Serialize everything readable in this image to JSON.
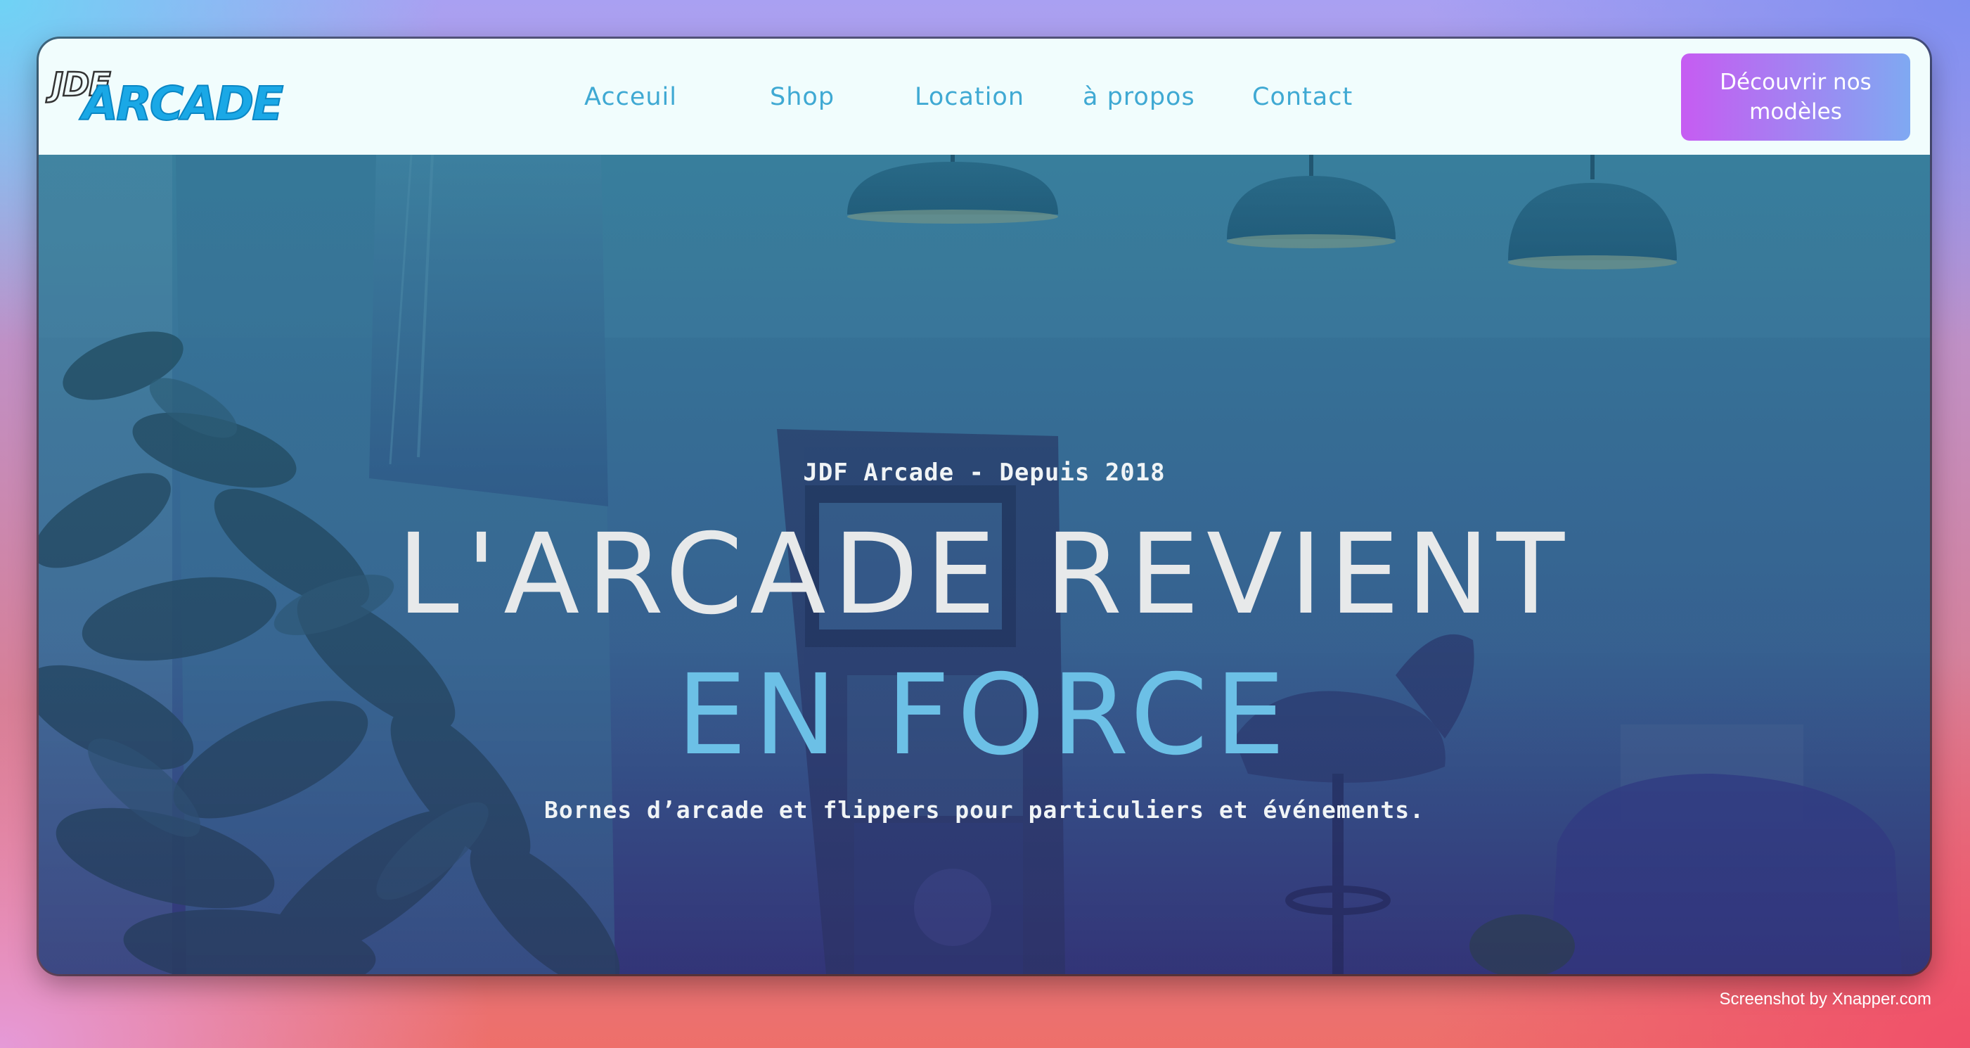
{
  "header": {
    "logo": {
      "top": "JDF",
      "bottom": "ARCADE"
    },
    "nav": [
      {
        "label": "Acceuil"
      },
      {
        "label": "Shop"
      },
      {
        "label": "Location"
      },
      {
        "label": "à propos"
      },
      {
        "label": "Contact"
      }
    ],
    "cta_label": "Découvrir nos modèles"
  },
  "hero": {
    "eyebrow": "JDF Arcade - Depuis 2018",
    "title_line1": "L'ARCADE REVIENT",
    "title_line2": "EN FORCE",
    "subtitle": "Bornes d’arcade et flippers pour particuliers et événements."
  },
  "footer": {
    "credit": "Screenshot by Xnapper.com"
  },
  "colors": {
    "header_bg": "#f1fdfd",
    "nav_link": "#3fa9d3",
    "cta_gradient_start": "#c65cf2",
    "cta_gradient_end": "#7fa9f2",
    "hero_title": "#e7e9ea",
    "hero_title_accent": "#6cc0e6"
  }
}
